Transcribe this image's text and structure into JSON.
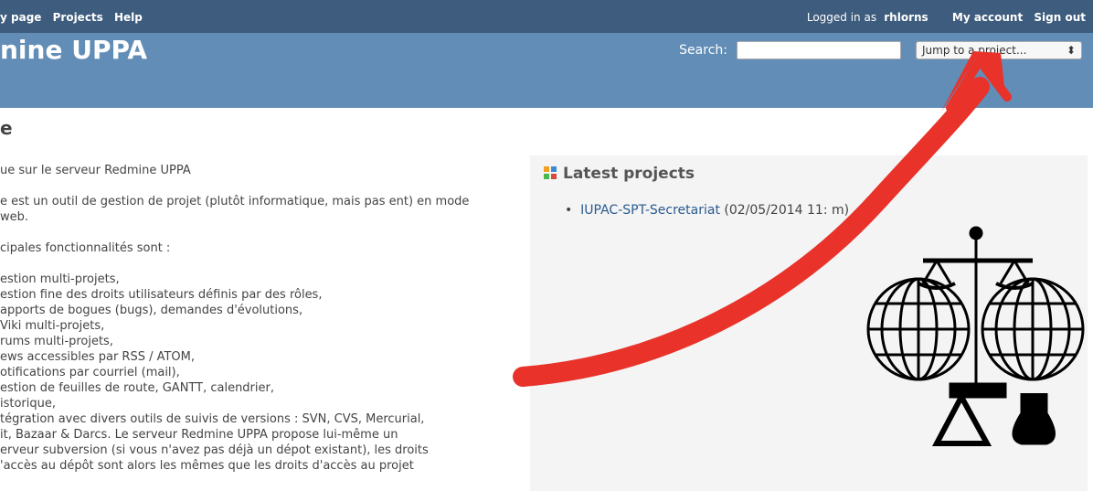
{
  "top_menu": {
    "links": [
      "y page",
      "Projects",
      "Help"
    ],
    "logged_in_text": "Logged in as",
    "username": "rhlorns",
    "my_account": "My account",
    "sign_out": "Sign out"
  },
  "header": {
    "title": "nine UPPA",
    "search_label": "Search:",
    "search_placeholder": "",
    "project_select": "Jump to a project..."
  },
  "page": {
    "title": "e",
    "welcome": "ue sur le serveur Redmine UPPA",
    "intro": "e est un outil de gestion de projet (plutôt informatique, mais pas ent) en mode web.",
    "features_heading": "cipales fonctionnalités sont :",
    "features": [
      "estion multi-projets,",
      "estion fine des droits utilisateurs définis par des rôles,",
      "apports de bogues (bugs), demandes d'évolutions,",
      "Viki multi-projets,",
      "rums multi-projets,",
      "ews accessibles par RSS / ATOM,",
      "otifications par courriel (mail),",
      "estion de feuilles de route, GANTT, calendrier,",
      "istorique,",
      "tégration avec divers outils de suivis de versions : SVN, CVS, Mercurial,",
      "it, Bazaar & Darcs. Le serveur Redmine UPPA propose lui-même un",
      "erveur subversion (si vous n'avez pas déjà un dépot existant), les droits",
      "'accès au dépôt sont alors les mêmes que les droits d'accès au projet"
    ]
  },
  "latest_projects": {
    "heading": "Latest projects",
    "project_name": "IUPAC-SPT-Secretariat",
    "project_date": "(02/05/2014 11:   m)"
  },
  "colors": {
    "top_menu": "#3e5c7d",
    "header": "#628db6",
    "arrow": "#e8322a"
  }
}
